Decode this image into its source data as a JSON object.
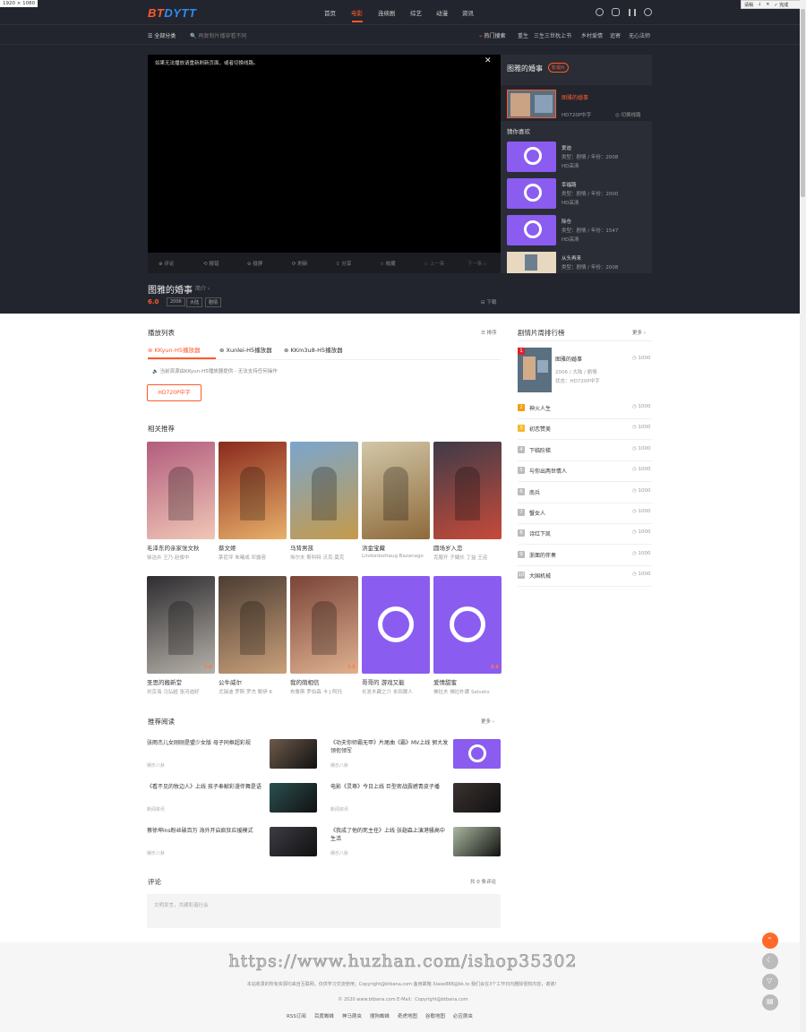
{
  "resolution_tag": "1920 × 1080",
  "browser_toolbar": {
    "items": [
      "请稍",
      "↓",
      "✕",
      "✓ 完成"
    ]
  },
  "header": {
    "logo": "BTDYTT",
    "nav": [
      "首页",
      "电影",
      "连续剧",
      "综艺",
      "动漫",
      "资讯"
    ],
    "active_nav": "电影",
    "icons": [
      "clock-icon",
      "comment-icon",
      "chart-icon",
      "user-icon"
    ]
  },
  "subbar": {
    "all_categories": "☰ 全部分类",
    "search_placeholder": "🔍 再复制片播穿看不同",
    "hot_label": "热门搜索",
    "hot_items": [
      "重生",
      "三生三世枕上书",
      "乡村爱情",
      "追寄",
      "无心法师"
    ]
  },
  "player": {
    "notice": "如果无法播放请重新刷新页面，或者切换线路。",
    "close": "✕",
    "controls": [
      "⊕ 评论",
      "⟲ 报错",
      "⊖ 投屏",
      "⟳ 刷新",
      "⇪ 分享",
      "☆ 收藏",
      "▷ 上一集",
      "下一集 ▷"
    ]
  },
  "sidebar": {
    "title": "图雅的婚事",
    "badge": "影视片",
    "current": {
      "title": "图雅的婚事",
      "quality": "HD720P中字",
      "switch": "◎ 切换线路"
    },
    "guess_label": "猜你喜欢",
    "items": [
      {
        "title": "爱迪",
        "meta": "类型：剧情 / 年份：2008",
        "q": "HD高清"
      },
      {
        "title": "幸福路",
        "meta": "类型：剧情 / 年份：2000",
        "q": "HD高清"
      },
      {
        "title": "除仓",
        "meta": "类型：剧情 / 年份：1547",
        "q": "HD高清"
      },
      {
        "title": "从头再来",
        "meta": "类型：剧情 / 年份：2008"
      }
    ]
  },
  "movie": {
    "title": "图雅的婚事",
    "intro": "简介 ›",
    "rating": "6.0",
    "tags": [
      "2006",
      "大陆",
      "剧情"
    ],
    "download": "⊟ 下载"
  },
  "playlist": {
    "title": "播放列表",
    "sort": "☰ 排序",
    "sources": [
      "KKyun-H5播放器",
      "Xunlei-H5播放器",
      "KKm3u8-H5播放器"
    ],
    "active_source": "KKyun-H5播放器",
    "notice": "🔈 当前资源由KKyun-H5播放器提供 - 无法支持任何操作",
    "episode": "HD720P中字"
  },
  "related": {
    "title": "相关推荐",
    "items": [
      {
        "t": "毛泽东的亲家张文秋",
        "s": "徐洁卉 王乃 赵俊中"
      },
      {
        "t": "蔡文姬",
        "s": "茅尼坪 朱曦成 邓露容"
      },
      {
        "t": "马背男孩",
        "s": "埃尔夫 斯科特 沃克·莫克"
      },
      {
        "t": "洪金宝藏",
        "s": "Lindonbottaug Bazanago"
      },
      {
        "t": "圆场岁入恋",
        "s": "克服开 子娟长 丁益 王运"
      },
      {
        "t": "圣思的搬新堂",
        "s": "刘京海 马弘超 张河迪好"
      },
      {
        "t": "公牛威尔",
        "s": "尤瑞迪 罗斯 罗杰 鲍伊 K"
      },
      {
        "t": "我的荫相信",
        "s": "布鲁斯 罗伯森 卡 J 阿托"
      },
      {
        "t": "哥哥的 游戏又能",
        "s": "长发木藏之介 本田翼人"
      },
      {
        "t": "爱情甜蜜",
        "s": "佛拉夫 佛拉朴娜 Selveto"
      }
    ],
    "badges": [
      "",
      "",
      "",
      "",
      "",
      "3.0",
      "",
      "2.0",
      "",
      "8.8"
    ]
  },
  "reading": {
    "title": "推荐阅读",
    "more": "更多 ›",
    "items": [
      {
        "t": "张雨杰儿女刚刚是盟少女版 母子同框超彩规",
        "s": "娱乐八卦"
      },
      {
        "t": "《功夫你师霸无甲》片尾曲《霸》MV上线 郭大发领衔领军",
        "s": "娱乐八卦"
      },
      {
        "t": "《看不见的牧边人》上线 孩子奉献彩漫伴舞是语",
        "s": "新闻资讯"
      },
      {
        "t": "电影《灵尊》今日上线 巨型密战震撼青皮子播",
        "s": "新闻资讯"
      },
      {
        "t": "蔡徐坤ins粉丝破百万 海外开启疯狂应援模式",
        "s": "娱乐八卦"
      },
      {
        "t": "《我成了他的死主任》上线 张翅森上演港骚高中生活",
        "s": "娱乐八卦"
      }
    ]
  },
  "comments": {
    "title": "评论",
    "count": "共 0 条评论",
    "placeholder": "文明发言，共建和谐社会"
  },
  "ranking": {
    "title": "剧情片周排行榜",
    "more": "更多 ›",
    "first": {
      "title": "图雅的婚事",
      "meta1": "2006 / 大陆 / 剧情",
      "meta2": "状态：HD720P中字",
      "views": "◷ 1000"
    },
    "items": [
      {
        "n": "2",
        "t": "神火人生",
        "v": "◷ 1000"
      },
      {
        "n": "3",
        "t": "初恋赞美",
        "v": "◷ 1000"
      },
      {
        "n": "4",
        "t": "下临阶梯",
        "v": "◷ 1000"
      },
      {
        "n": "5",
        "t": "与你出两世情人",
        "v": "◷ 1000"
      },
      {
        "n": "6",
        "t": "南兵",
        "v": "◷ 1000"
      },
      {
        "n": "7",
        "t": "蟹女人",
        "v": "◷ 1000"
      },
      {
        "n": "8",
        "t": "诗红下凯",
        "v": "◷ 1000"
      },
      {
        "n": "9",
        "t": "浙面的伴奏",
        "v": "◷ 1000"
      },
      {
        "n": "10",
        "t": "大国机械",
        "v": "◷ 1000"
      }
    ],
    "colors": [
      "#e0202a",
      "#f39c12",
      "#f5b82a"
    ]
  },
  "watermark": "https://www.huzhan.com/ishop35302",
  "footer": {
    "disclaimer": "本站收录的所有资源均来自互联网，仅供学习交流使用；Copyright@btbana.com 备用邮箱 Xiaoe888@bk.to 我们会在3个工作日内删除侵权内容，谢谢！",
    "copyright": "© 2020 www.btbana.com  E-Mail：Copyright@btbana.com",
    "links": [
      "RSS订阅",
      "百度蜘蛛",
      "神马爬虫",
      "搜狗蜘蛛",
      "奇虎地图",
      "谷歌地图",
      "必应爬虫"
    ]
  },
  "float_buttons": [
    "up-icon",
    "moon-icon",
    "filter-icon",
    "note-icon"
  ]
}
